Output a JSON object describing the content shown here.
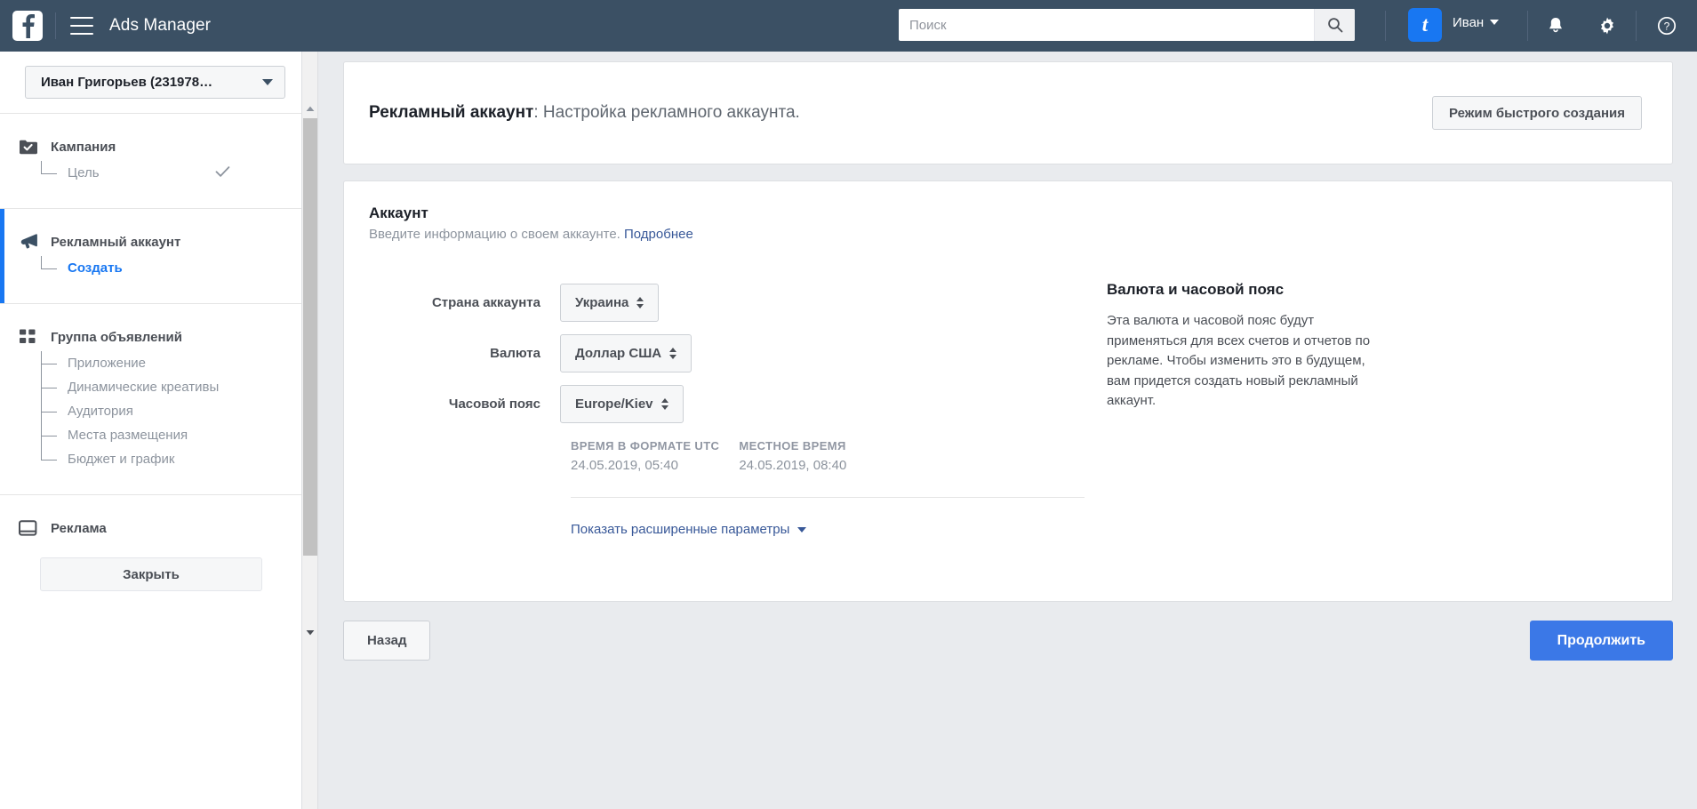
{
  "topbar": {
    "logo_icon": "facebook-logo-icon",
    "menu_icon": "hamburger-menu-icon",
    "app_title": "Ads Manager",
    "search_placeholder": "Поиск",
    "search_value": "",
    "search_icon": "search-icon",
    "avatar_letter": "t",
    "user_name": "Иван",
    "notifications_icon": "bell-icon",
    "settings_icon": "gear-icon",
    "help_icon": "help-circle-icon"
  },
  "sidebar": {
    "account_selector": "Иван Григорьев (231978…",
    "sections": [
      {
        "label": "Кампания",
        "icon": "folder-check-icon",
        "active": false,
        "children": [
          {
            "label": "Цель",
            "active": false,
            "completed": true
          }
        ]
      },
      {
        "label": "Рекламный аккаунт",
        "icon": "megaphone-icon",
        "active": true,
        "children": [
          {
            "label": "Создать",
            "active": true,
            "completed": false
          }
        ]
      },
      {
        "label": "Группа объявлений",
        "icon": "grid-squares-icon",
        "active": false,
        "children": [
          {
            "label": "Приложение",
            "active": false,
            "completed": false
          },
          {
            "label": "Динамические креативы",
            "active": false,
            "completed": false
          },
          {
            "label": "Аудитория",
            "active": false,
            "completed": false
          },
          {
            "label": "Места размещения",
            "active": false,
            "completed": false
          },
          {
            "label": "Бюджет и график",
            "active": false,
            "completed": false
          }
        ]
      },
      {
        "label": "Реклама",
        "icon": "window-icon",
        "active": false,
        "children": []
      }
    ],
    "close_button": "Закрыть",
    "scrollbar": {
      "up_icon": "scroll-up-arrow-icon",
      "down_icon": "scroll-down-arrow-icon"
    }
  },
  "main": {
    "header": {
      "title_bold": "Рекламный аккаунт",
      "title_rest": ": Настройка рекламного аккаунта.",
      "quick_create_button": "Режим быстрого создания"
    },
    "account_section": {
      "title": "Аккаунт",
      "subtitle": "Введите информацию о своем аккаунте.",
      "learn_more": "Подробнее",
      "fields": [
        {
          "label": "Страна аккаунта",
          "value": "Украина"
        },
        {
          "label": "Валюта",
          "value": "Доллар США"
        },
        {
          "label": "Часовой пояс",
          "value": "Europe/Kiev"
        }
      ],
      "times": [
        {
          "caption": "ВРЕМЯ В ФОРМАТЕ UTC",
          "value": "24.05.2019, 05:40"
        },
        {
          "caption": "МЕСТНОЕ ВРЕМЯ",
          "value": "24.05.2019, 08:40"
        }
      ],
      "advanced_link": "Показать расширенные параметры"
    },
    "help": {
      "title": "Валюта и часовой пояс",
      "text": "Эта валюта и часовой пояс будут применяться для всех счетов и отчетов по рекламе. Чтобы изменить это в будущем, вам придется создать новый рекламный аккаунт."
    },
    "footer": {
      "back_button": "Назад",
      "continue_button": "Продолжить"
    }
  },
  "colors": {
    "topbar_bg": "#3b5064",
    "accent_blue": "#1877f2",
    "primary_button": "#3b78e7",
    "link_blue": "#385898",
    "page_bg": "#e9ebee"
  }
}
